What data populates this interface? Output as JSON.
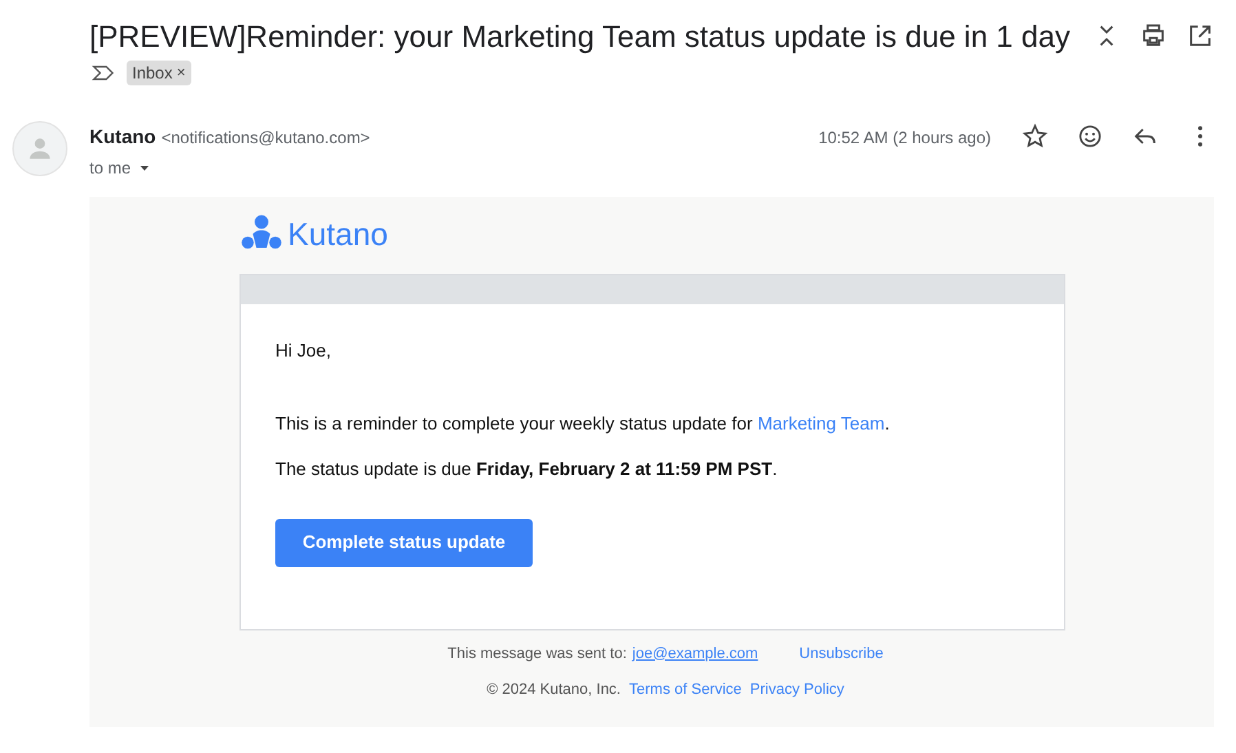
{
  "subject": "[PREVIEW]Reminder: your Marketing Team status update is due in 1 day",
  "labels": [
    {
      "text": "Inbox",
      "remove": "×"
    }
  ],
  "sender": {
    "name": "Kutano",
    "email": "<notifications@kutano.com>",
    "recipient": "to me",
    "time": "10:52 AM (2 hours ago)"
  },
  "body": {
    "brand": "Kutano",
    "greeting": "Hi Joe,",
    "reminder": {
      "before": "This is a reminder to complete your weekly status update for ",
      "link": "Marketing Team",
      "after": "."
    },
    "due": "The status update is due **Friday, February 2 at 11:59 PM PST**.",
    "button": "Complete status update"
  },
  "footer": {
    "sent_to_label": "This message was sent to:",
    "sent_to_email": "joe@example.com",
    "unsubscribe": "Unsubscribe",
    "copyright": "© 2024 Kutano, Inc.",
    "links": [
      "Terms of Service",
      "Privacy Policy"
    ]
  }
}
